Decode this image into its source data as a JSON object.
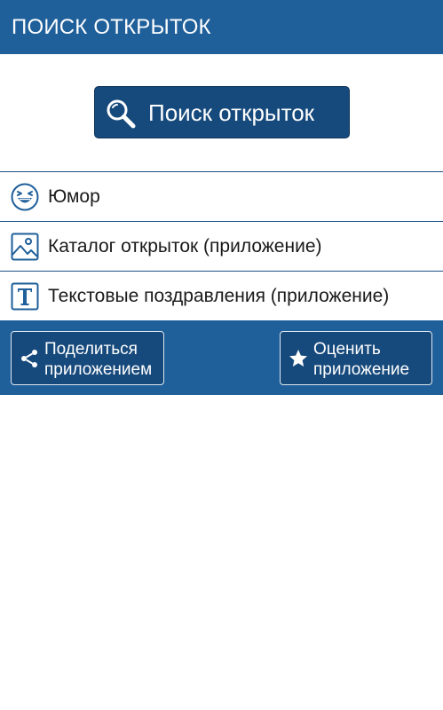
{
  "app_bar": {
    "title": "ПОИСК ОТКРЫТОК"
  },
  "search_button": {
    "label": "Поиск открыток",
    "icon": "search-icon"
  },
  "menu": {
    "items": [
      {
        "label": "Юмор",
        "icon": "laughing-face-icon"
      },
      {
        "label": "Каталог открыток (приложение)",
        "icon": "image-icon"
      },
      {
        "label": "Текстовые поздравления (приложение)",
        "icon": "text-t-icon"
      }
    ]
  },
  "footer": {
    "share": {
      "line1": "Поделиться",
      "line2": "приложением",
      "icon": "share-icon"
    },
    "rate": {
      "line1": "Оценить",
      "line2": "приложение",
      "icon": "star-icon"
    }
  },
  "colors": {
    "primary": "#1f5f9a",
    "button_dark": "#174a7c",
    "divider": "#1f4f86"
  }
}
